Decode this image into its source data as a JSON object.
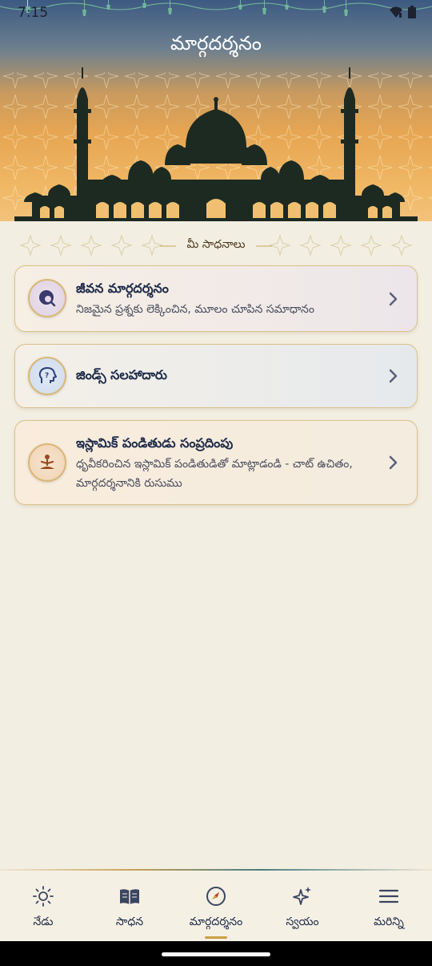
{
  "status_bar": {
    "time": "7:15"
  },
  "header": {
    "title": "మార్గదర్శనం"
  },
  "section": {
    "label": "మీ సాధనాలు"
  },
  "cards": [
    {
      "title": "జీవన మార్గదర్శనం",
      "subtitle": "నిజమైన ప్రశ్నకు లెక్కించిన, మూలం చూపిన సమాధానం",
      "icon": "search-globe-icon"
    },
    {
      "title": "జిండ్స్ సలహాదారు",
      "subtitle": "",
      "icon": "head-question-icon"
    },
    {
      "title": "ఇస్లామిక్ పండితుడు సంప్రదింపు",
      "subtitle": "ధృవీకరించిన ఇస్లామిక్ పండితుడితో మాట్లాడండి - చాట్ ఉచితం, మార్గదర్శనానికి రుసుము",
      "icon": "meditating-person-icon"
    }
  ],
  "bottom_nav": [
    {
      "label": "నేడు",
      "icon": "sun-icon",
      "active": false
    },
    {
      "label": "సాధన",
      "icon": "book-icon",
      "active": false
    },
    {
      "label": "మార్గదర్శనం",
      "icon": "compass-icon",
      "active": true
    },
    {
      "label": "స్వయం",
      "icon": "sparkles-icon",
      "active": false
    },
    {
      "label": "మరిన్ని",
      "icon": "menu-icon",
      "active": false
    }
  ],
  "colors": {
    "accent_gold": "#c9a040",
    "navy_text": "#1d2a48",
    "background": "#f3eee2"
  }
}
